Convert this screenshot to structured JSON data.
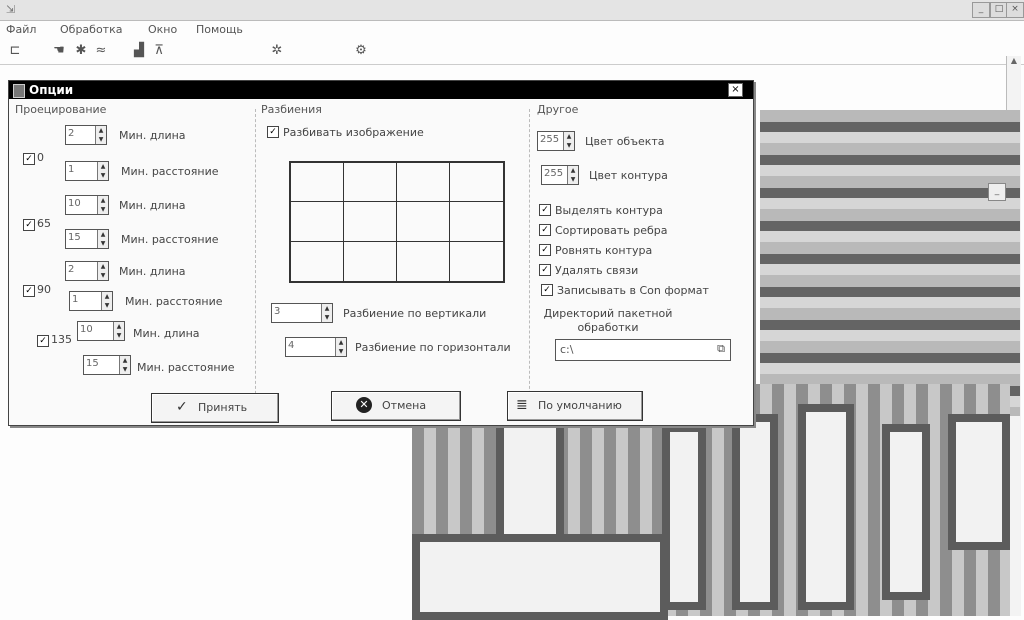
{
  "window": {
    "minimize": "_",
    "maximize": "□",
    "close": "×"
  },
  "menu": [
    "Файл",
    "Обработка",
    "Окно",
    "Помощь"
  ],
  "toolbar_icons": [
    "open-file-icon",
    "hand-icon",
    "transform-icon",
    "process-icon",
    "histogram-icon",
    "filter-icon",
    "star-icon",
    "settings-icon"
  ],
  "dialog": {
    "title": "Опции",
    "close": "×",
    "projection": {
      "label": "Проецирование",
      "groups": [
        {
          "angle": "0",
          "checked": true,
          "min_length": "2",
          "min_distance": "1"
        },
        {
          "angle": "65",
          "checked": true,
          "min_length": "10",
          "min_distance": "15"
        },
        {
          "angle": "90",
          "checked": true,
          "min_length": "2",
          "min_distance": "1"
        },
        {
          "angle": "135",
          "checked": true,
          "min_length": "10",
          "min_distance": "15"
        }
      ],
      "min_length_label": "Мин. длина",
      "min_distance_label": "Мин. расстояние",
      "min_length_label_alt": "Мин. длина",
      "min_distance_label_alt": "Мин. расстояние"
    },
    "split": {
      "label": "Разбиения",
      "split_image_label": "Разбивать изображение",
      "split_image_checked": true,
      "grid_rows": 3,
      "grid_cols": 4,
      "vertical_value": "3",
      "vertical_label": "Разбиение по вертикали",
      "horizontal_value": "4",
      "horizontal_label": "Разбиение по горизонтали"
    },
    "other": {
      "label": "Другое",
      "object_color_value": "255",
      "object_color_label": "Цвет объекта",
      "contour_color_value": "255",
      "contour_color_label": "Цвет контура",
      "checkboxes": [
        {
          "label": "Выделять контура",
          "checked": true
        },
        {
          "label": "Сортировать ребра",
          "checked": true
        },
        {
          "label": "Ровнять контура",
          "checked": true
        },
        {
          "label": "Удалять связи",
          "checked": true
        },
        {
          "label": "Записывать в Con формат",
          "checked": true
        }
      ],
      "batch_dir_label": "Директорий пакетной обработки",
      "batch_dir_value": "c:\\"
    },
    "buttons": {
      "accept": "Принять",
      "cancel": "Отмена",
      "default": "По умолчанию"
    }
  }
}
